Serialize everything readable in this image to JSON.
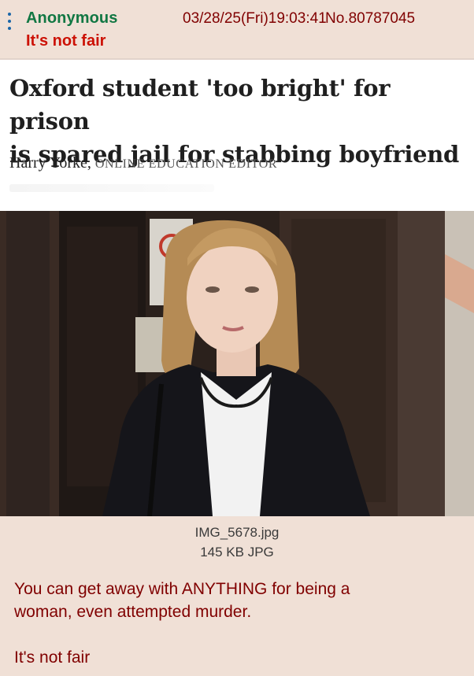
{
  "post": {
    "name": "Anonymous",
    "subject": "It's not fair",
    "datetime": "03/28/25(Fri)19:03:41",
    "number": "No.80787045",
    "file": {
      "filename": "IMG_5678.jpg",
      "meta": "145 KB JPG"
    },
    "comment": {
      "line1": "You can get away with ANYTHING for being a",
      "line2": "woman, even attempted murder.",
      "line3": "It's not fair"
    }
  },
  "article": {
    "headline_line1": "Oxford student 'too bright' for prison",
    "headline_line2": "is spared jail for stabbing boyfriend",
    "author": "Harry Yorke,",
    "role": "ONLINE EDUCATION EDITOR"
  },
  "colors": {
    "post_bg": "#f0e0d6",
    "name": "#117743",
    "subject": "#cc1105",
    "text": "#800000"
  },
  "icons": {
    "menu": "post-menu-icon"
  }
}
